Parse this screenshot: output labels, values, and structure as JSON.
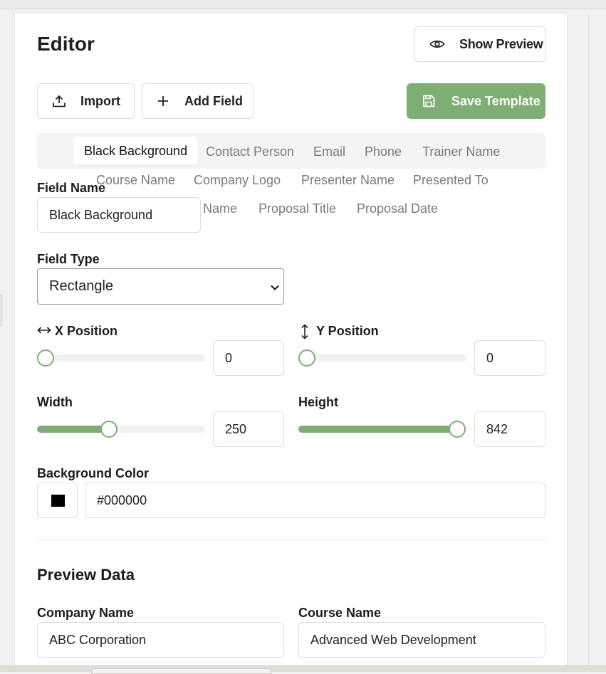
{
  "editor": {
    "title": "Editor",
    "show_preview_label": "Show Preview",
    "import_label": "Import",
    "add_field_label": "Add Field",
    "save_label": "Save Template"
  },
  "tabs": {
    "active": "Black Background",
    "row1": [
      "Contact Person",
      "Email",
      "Phone",
      "Trainer Name"
    ],
    "row2": [
      "Course Name",
      "Company Logo",
      "Presenter Name",
      "Presented To"
    ],
    "row3": [
      "Name",
      "Proposal Title",
      "Proposal Date"
    ]
  },
  "field": {
    "name_label": "Field Name",
    "name_value": "Black Background",
    "type_label": "Field Type",
    "type_value": "Rectangle",
    "x_label": "X Position",
    "x_value": "0",
    "y_label": "Y Position",
    "y_value": "0",
    "width_label": "Width",
    "width_value": "250",
    "height_label": "Height",
    "height_value": "842",
    "bg_label": "Background Color",
    "bg_value": "#000000"
  },
  "sliders": {
    "x_fraction": 0.0,
    "y_fraction": 0.0,
    "width_fraction": 0.42,
    "height_fraction": 1.0
  },
  "preview": {
    "title": "Preview Data",
    "company_label": "Company Name",
    "company_value": "ABC Corporation",
    "course_label": "Course Name",
    "course_value": "Advanced Web Development"
  },
  "colors": {
    "accent": "#7eae73",
    "swatch": "#000000"
  },
  "icons": {
    "show_preview": "eye-icon",
    "import": "upload-icon",
    "add_field": "plus-icon",
    "save": "save-icon",
    "x_position": "horizontal-arrows-icon",
    "y_position": "vertical-arrows-icon",
    "select": "chevron-down-icon"
  }
}
